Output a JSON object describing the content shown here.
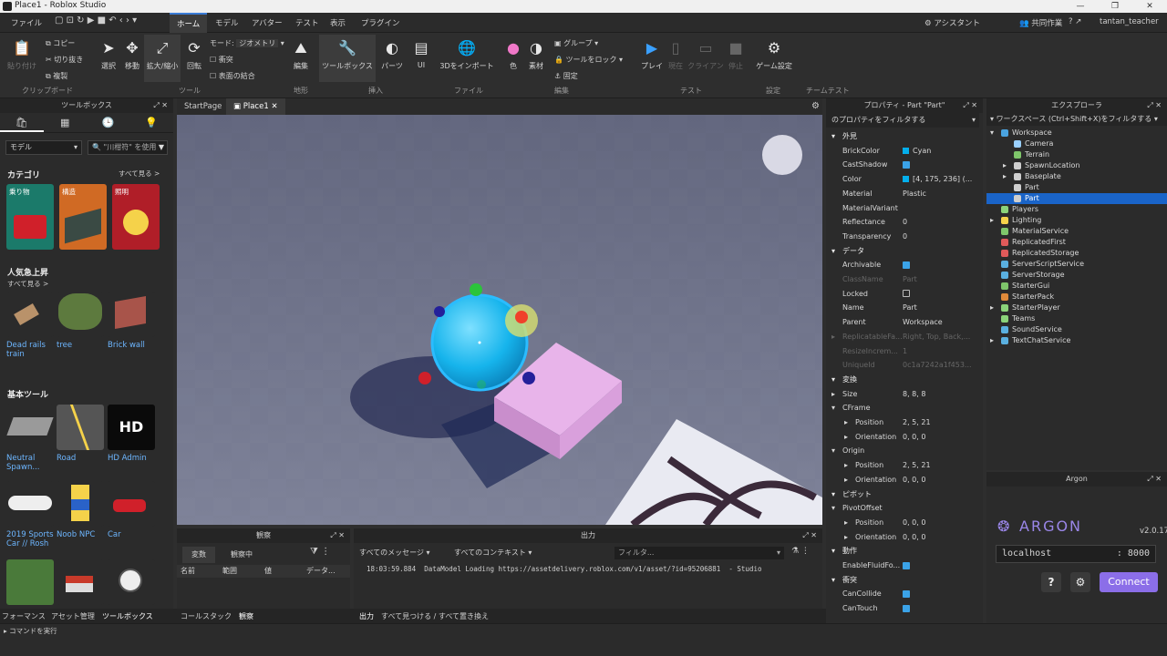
{
  "window": {
    "title": "Place1 - Roblox Studio",
    "controls": [
      "—",
      "❐",
      "✕"
    ]
  },
  "menu": {
    "items": [
      "ファイル",
      "ホーム",
      "モデル",
      "アバター",
      "テスト",
      "表示",
      "プラグイン"
    ],
    "active": "ホーム",
    "assistant": "アシスタント",
    "collab": "共同作業",
    "user": "tantan_teacher"
  },
  "ribbon": {
    "paste": "貼り付け",
    "copy": "コピー",
    "cut": "切り抜き",
    "duplicate": "複製",
    "clipboard": "クリップボード",
    "select": "選択",
    "move": "移動",
    "scale": "拡大/縮小",
    "rotate": "回転",
    "mode_label": "モード:",
    "mode_value": "ジオメトリ",
    "collision": "衝突",
    "join": "表面の結合",
    "tool": "ツール",
    "edit": "編集",
    "terrain": "地形",
    "toolbox": "ツールボックス",
    "parts": "パーツ",
    "ui": "UI",
    "insert": "挿入",
    "import3d": "3Dをインポート",
    "file": "ファイル",
    "color": "色",
    "material": "素材",
    "group": "グループ",
    "lock": "ツールをロック",
    "anchor": "固定",
    "editing": "編集",
    "play": "プレイ",
    "current": "現在",
    "client": "クライアン",
    "stop": "停止",
    "test": "テスト",
    "gamesettings": "ゲーム設定",
    "settings": "設定",
    "teamtest": "チームテスト"
  },
  "toolbox": {
    "title": "ツールボックス",
    "tabs": [
      "🛍",
      "▦",
      "🕒",
      "💡"
    ],
    "filter": "モデル",
    "search_placeholder": "\"川柑符\" を使用",
    "category": "カテゴリ",
    "seeall": "すべて見る >",
    "categories": [
      {
        "label": "乗り物"
      },
      {
        "label": "構造"
      },
      {
        "label": "照明"
      }
    ],
    "trending": "人気急上昇",
    "trending_seeall": "すべて見る >",
    "trending_items": [
      "Dead rails train",
      "tree",
      "Brick wall"
    ],
    "basic": "基本ツール",
    "basic_items": [
      "Neutral Spawn...",
      "Road",
      "HD Admin"
    ],
    "more_items": [
      "2019 Sports Car // Rosh",
      "Noob NPC",
      "Car"
    ],
    "hd_text": "HD"
  },
  "doc_tabs": [
    "StartPage",
    "Place1"
  ],
  "watch": {
    "title": "観察",
    "tabs": [
      "変数",
      "観察中"
    ],
    "cols": [
      "名前",
      "範囲",
      "値",
      "データ..."
    ]
  },
  "output": {
    "title": "出力",
    "msg_filter": "すべてのメッセージ",
    "ctx_filter": "すべてのコンテキスト",
    "filter_placeholder": "フィルタ...",
    "log": {
      "time": "18:03:59.884",
      "text": "DataModel Loading https://assetdelivery.roblox.com/v1/asset/?id=95206881",
      "src": "- Studio"
    }
  },
  "bottom_tabs": [
    "フォーマンス",
    "アセット管理",
    "ツールボックス",
    "コールスタック",
    "観察",
    "出力",
    "すべて見つける / すべて置き換え"
  ],
  "status": {
    "command": "コマンドを実行"
  },
  "properties": {
    "title": "プロパティ - Part \"Part\"",
    "filter": "のプロパティをフィルタする",
    "rows": [
      {
        "t": "cat",
        "n": "外見"
      },
      {
        "t": "p",
        "k": "BrickColor",
        "v": "Cyan",
        "sw": true
      },
      {
        "t": "p",
        "k": "CastShadow",
        "chk": true
      },
      {
        "t": "p",
        "k": "Color",
        "v": "[4, 175, 236] (...",
        "sw": true
      },
      {
        "t": "p",
        "k": "Material",
        "v": "Plastic"
      },
      {
        "t": "p",
        "k": "MaterialVariant",
        "v": ""
      },
      {
        "t": "p",
        "k": "Reflectance",
        "v": "0"
      },
      {
        "t": "p",
        "k": "Transparency",
        "v": "0"
      },
      {
        "t": "cat",
        "n": "データ"
      },
      {
        "t": "p",
        "k": "Archivable",
        "chk": true
      },
      {
        "t": "p",
        "k": "ClassName",
        "v": "Part",
        "dim": true
      },
      {
        "t": "p",
        "k": "Locked",
        "chk": false
      },
      {
        "t": "p",
        "k": "Name",
        "v": "Part"
      },
      {
        "t": "p",
        "k": "Parent",
        "v": "Workspace"
      },
      {
        "t": "p",
        "k": "ReplicatableFa...",
        "v": "Right, Top, Back,...",
        "dim": true,
        "exp": true
      },
      {
        "t": "p",
        "k": "ResizeIncrem...",
        "v": "1",
        "dim": true
      },
      {
        "t": "p",
        "k": "UniqueId",
        "v": "0c1a7242a1f453...",
        "dim": true
      },
      {
        "t": "cat",
        "n": "変換"
      },
      {
        "t": "p",
        "k": "Size",
        "v": "8, 8, 8",
        "exp": true
      },
      {
        "t": "p",
        "k": "CFrame",
        "v": "",
        "exp": true,
        "open": true
      },
      {
        "t": "s",
        "k": "Position",
        "v": "2, 5, 21"
      },
      {
        "t": "s",
        "k": "Orientation",
        "v": "0, 0, 0"
      },
      {
        "t": "p",
        "k": "Origin",
        "v": "",
        "exp": true,
        "open": true
      },
      {
        "t": "s",
        "k": "Position",
        "v": "2, 5, 21"
      },
      {
        "t": "s",
        "k": "Orientation",
        "v": "0, 0, 0"
      },
      {
        "t": "cat",
        "n": "ピボット"
      },
      {
        "t": "p",
        "k": "PivotOffset",
        "v": "",
        "open": true
      },
      {
        "t": "s",
        "k": "Position",
        "v": "0, 0, 0"
      },
      {
        "t": "s",
        "k": "Orientation",
        "v": "0, 0, 0"
      },
      {
        "t": "cat",
        "n": "動作"
      },
      {
        "t": "p",
        "k": "EnableFluidFo...",
        "chk": true
      },
      {
        "t": "cat",
        "n": "衝突"
      },
      {
        "t": "p",
        "k": "CanCollide",
        "chk": true
      },
      {
        "t": "p",
        "k": "CanTouch",
        "chk": true
      }
    ]
  },
  "explorer": {
    "title": "エクスプローラ",
    "filter": "ワークスペース (Ctrl+Shift+X)をフィルタする",
    "items": [
      {
        "n": "Workspace",
        "l": 0,
        "e": "open",
        "c": "#4aa3df"
      },
      {
        "n": "Camera",
        "l": 1,
        "c": "#9ad0ff"
      },
      {
        "n": "Terrain",
        "l": 1,
        "c": "#7fc66b"
      },
      {
        "n": "SpawnLocation",
        "l": 1,
        "e": "closed",
        "c": "#cfcfcf"
      },
      {
        "n": "Baseplate",
        "l": 1,
        "e": "closed",
        "c": "#cfcfcf"
      },
      {
        "n": "Part",
        "l": 1,
        "c": "#cfcfcf"
      },
      {
        "n": "Part",
        "l": 1,
        "c": "#cfcfcf",
        "sel": true
      },
      {
        "n": "Players",
        "l": 0,
        "c": "#8bd37a"
      },
      {
        "n": "Lighting",
        "l": 0,
        "e": "closed",
        "c": "#f5d24a"
      },
      {
        "n": "MaterialService",
        "l": 0,
        "c": "#7fc66b"
      },
      {
        "n": "ReplicatedFirst",
        "l": 0,
        "c": "#e05a5a"
      },
      {
        "n": "ReplicatedStorage",
        "l": 0,
        "c": "#e05a5a"
      },
      {
        "n": "ServerScriptService",
        "l": 0,
        "c": "#5ab0e0"
      },
      {
        "n": "ServerStorage",
        "l": 0,
        "c": "#5ab0e0"
      },
      {
        "n": "StarterGui",
        "l": 0,
        "c": "#7fc66b"
      },
      {
        "n": "StarterPack",
        "l": 0,
        "c": "#e08a3a"
      },
      {
        "n": "StarterPlayer",
        "l": 0,
        "e": "closed",
        "c": "#8bd37a"
      },
      {
        "n": "Teams",
        "l": 0,
        "c": "#8bd37a"
      },
      {
        "n": "SoundService",
        "l": 0,
        "c": "#5ab0e0"
      },
      {
        "n": "TextChatService",
        "l": 0,
        "e": "closed",
        "c": "#5ab0e0"
      }
    ]
  },
  "argon": {
    "title": "Argon",
    "brand": "ARGON",
    "version": "v2.0.17",
    "host": "localhost",
    "port": ": 8000",
    "help": "?",
    "connect": "Connect"
  }
}
